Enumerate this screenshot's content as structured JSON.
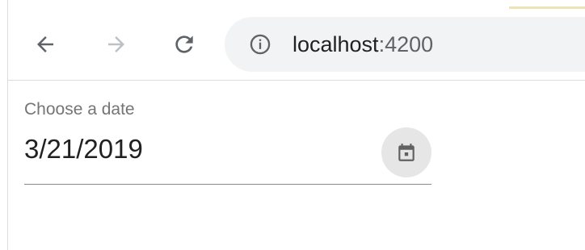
{
  "browser": {
    "url_host": "localhost",
    "url_port": ":4200",
    "icons": {
      "back": "arrow-left-icon",
      "forward": "arrow-right-icon",
      "reload": "reload-icon",
      "site_info": "info-icon"
    },
    "colors": {
      "toolbar_bg": "#ffffff",
      "omnibox_bg": "#f1f3f4",
      "icon_active": "#5f6368",
      "icon_disabled": "#bdc1c6",
      "tab_accent": "#efe2b6"
    }
  },
  "datepicker": {
    "label": "Choose a date",
    "value": "3/21/2019",
    "toggle_icon": "calendar-icon",
    "colors": {
      "label": "#757575",
      "value": "#212121",
      "underline": "#8a8a8a",
      "toggle_bg": "#e6e6e6",
      "toggle_icon": "#616161"
    }
  }
}
